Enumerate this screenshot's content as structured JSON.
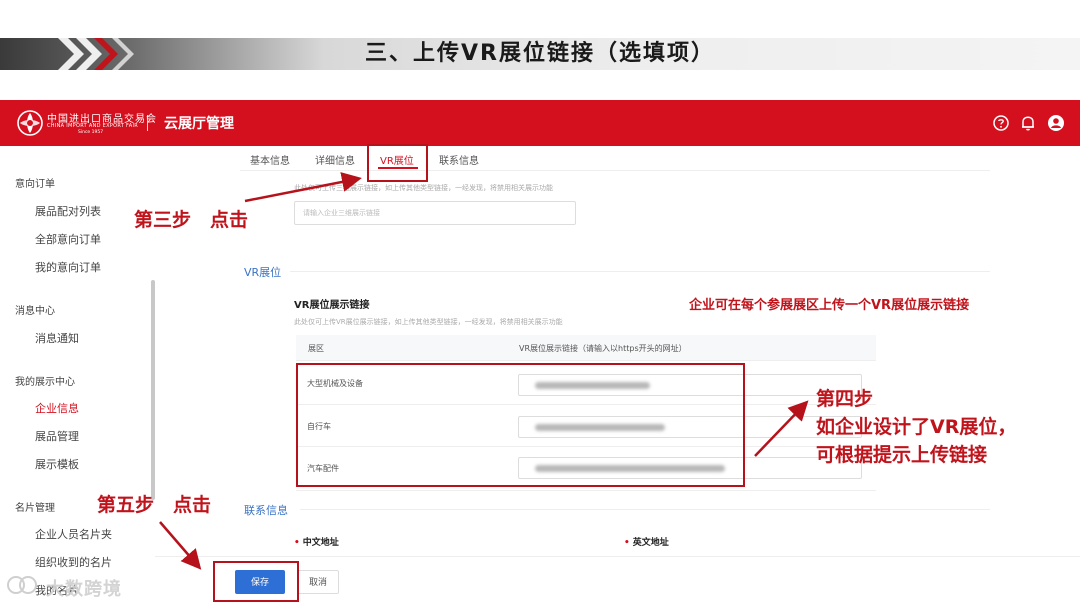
{
  "slide": {
    "title": "三、上传VR展位链接（选填项）"
  },
  "header": {
    "logo_cn": "中国进出口商品交易会",
    "logo_en": "CHINA IMPORT AND EXPORT FAIR",
    "logo_since": "Since 1957",
    "title": "云展厅管理",
    "icons": [
      "help-icon",
      "bell-icon",
      "user-icon"
    ],
    "brand_color": "#d4101f"
  },
  "sidebar": {
    "groups": [
      {
        "label": "意向订单",
        "items": [
          "展品配对列表",
          "全部意向订单",
          "我的意向订单"
        ]
      },
      {
        "label": "消息中心",
        "items": [
          "消息通知"
        ]
      },
      {
        "label": "我的展示中心",
        "items": [
          "企业信息",
          "展品管理",
          "展示模板"
        ]
      },
      {
        "label": "名片管理",
        "items": [
          "企业人员名片夹",
          "组织收到的名片",
          "我的名片"
        ]
      }
    ],
    "active_item": "企业信息"
  },
  "tabs": [
    "基本信息",
    "详细信息",
    "VR展位",
    "联系信息"
  ],
  "active_tab": "VR展位",
  "upper_section": {
    "hint": "此处仅可上传三维展示链接，如上传其他类型链接，一经发现，将禁用相关展示功能",
    "placeholder": "请输入企业三维展示链接"
  },
  "vr_section": {
    "heading": "VR展位",
    "subtitle": "VR展位展示链接",
    "hint": "此处仅可上传VR展位展示链接，如上传其他类型链接，一经发现，将禁用相关展示功能",
    "col_zone": "展区",
    "col_link": "VR展位展示链接（请输入以https开头的网址）",
    "rows": [
      {
        "zone": "大型机械及设备"
      },
      {
        "zone": "自行车"
      },
      {
        "zone": "汽车配件"
      }
    ]
  },
  "contact_section": {
    "heading": "联系信息",
    "cn_address": "中文地址",
    "en_address": "英文地址"
  },
  "buttons": {
    "save": "保存",
    "cancel": "取消"
  },
  "annotations": {
    "step3": "第三步　点击",
    "note": "企业可在每个参展展区上传一个VR展位展示链接",
    "step4_line1": "第四步",
    "step4_line2": "如企业设计了VR展位，",
    "step4_line3": "可根据提示上传链接",
    "step5": "第五步　点击",
    "color": "#c0141c"
  },
  "watermark": "大数跨境"
}
